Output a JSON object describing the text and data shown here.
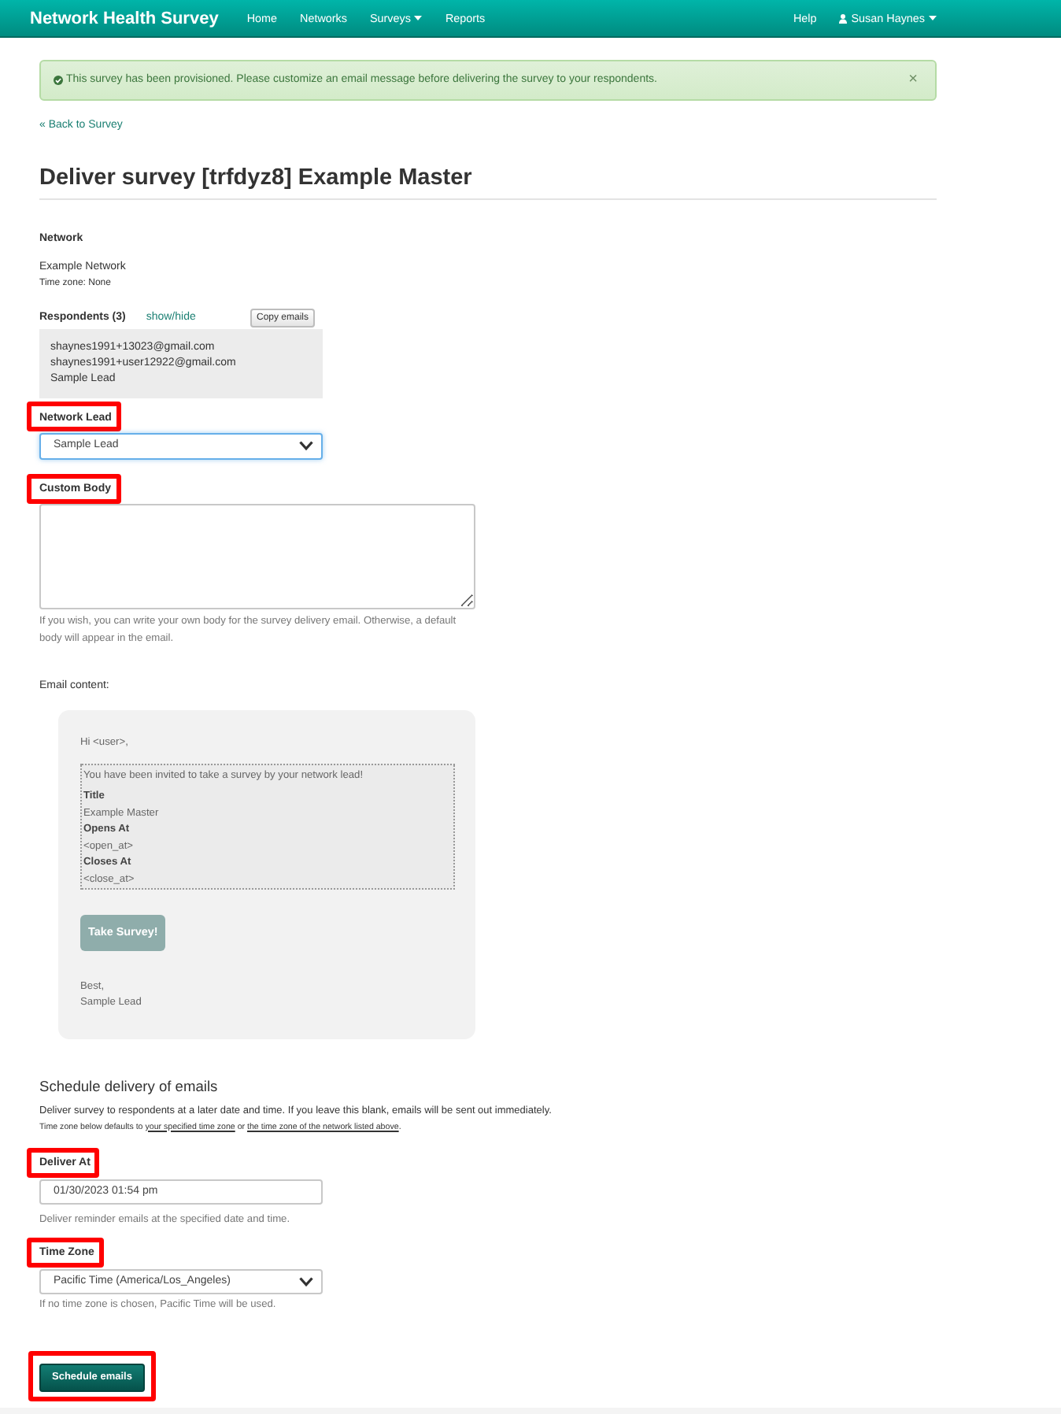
{
  "navbar": {
    "brand": "Network Health Survey",
    "links": [
      {
        "label": "Home",
        "dropdown": false
      },
      {
        "label": "Networks",
        "dropdown": false
      },
      {
        "label": "Surveys",
        "dropdown": true
      },
      {
        "label": "Reports",
        "dropdown": false
      }
    ],
    "right_links": [
      {
        "label": "Help",
        "dropdown": false,
        "user_icon": false
      },
      {
        "label": "Susan Haynes",
        "dropdown": true,
        "user_icon": true
      }
    ]
  },
  "alert": {
    "message": "This survey has been provisioned. Please customize an email message before delivering the survey to your respondents.",
    "close": "×"
  },
  "back_link": "« Back to Survey",
  "title": "Deliver survey [trfdyz8] Example Master",
  "network": {
    "heading": "Network",
    "name": "Example Network",
    "time_zone": "Time zone: None"
  },
  "respondents": {
    "heading": "Respondents (3)",
    "toggle": "show/hide",
    "copy_button": "Copy emails",
    "expanded": true,
    "items": [
      "shaynes1991+13023@gmail.com",
      "shaynes1991+user12922@gmail.com",
      "Sample Lead"
    ]
  },
  "network_lead": {
    "label": "Network Lead",
    "highlighted": true,
    "value": "Sample Lead",
    "focused": true
  },
  "custom_body": {
    "label": "Custom Body",
    "highlighted": true,
    "help": "If you wish, you can write your own body for the survey delivery email. Otherwise, a default body will appear in the email."
  },
  "email_preview": {
    "label": "Email content:",
    "greeting": "Hi <user>,",
    "intro": "You have been invited to take a survey by your network lead!",
    "fields": [
      {
        "label": "Title",
        "value": "Example Master"
      },
      {
        "label": "Opens At",
        "value": "<open_at>"
      },
      {
        "label": "Closes At",
        "value": "<close_at>"
      }
    ],
    "button": "Take Survey!",
    "signoff": "Best,",
    "signature": "Sample Lead"
  },
  "schedule": {
    "heading": "Schedule delivery of emails",
    "intro": "Deliver survey to respondents at a later date and time. If you leave this blank, emails will be sent out immediately.",
    "note": [
      {
        "kind": "text",
        "text": "Time zone below defaults to "
      },
      {
        "kind": "link",
        "text": "your specified time zone"
      },
      {
        "kind": "text",
        "text": " or "
      },
      {
        "kind": "link",
        "text": "the time zone of the network listed above"
      },
      {
        "kind": "text",
        "text": "."
      }
    ]
  },
  "deliver_at": {
    "label": "Deliver At",
    "highlighted": true,
    "value": "01/30/2023 01:54 pm",
    "help": "Deliver reminder emails at the specified date and time."
  },
  "time_zone": {
    "label": "Time Zone",
    "highlighted": true,
    "value": "Pacific Time (America/Los_Angeles)",
    "help": "If no time zone is chosen, Pacific Time will be used."
  },
  "submit": {
    "label": "Schedule emails",
    "highlighted": true
  }
}
